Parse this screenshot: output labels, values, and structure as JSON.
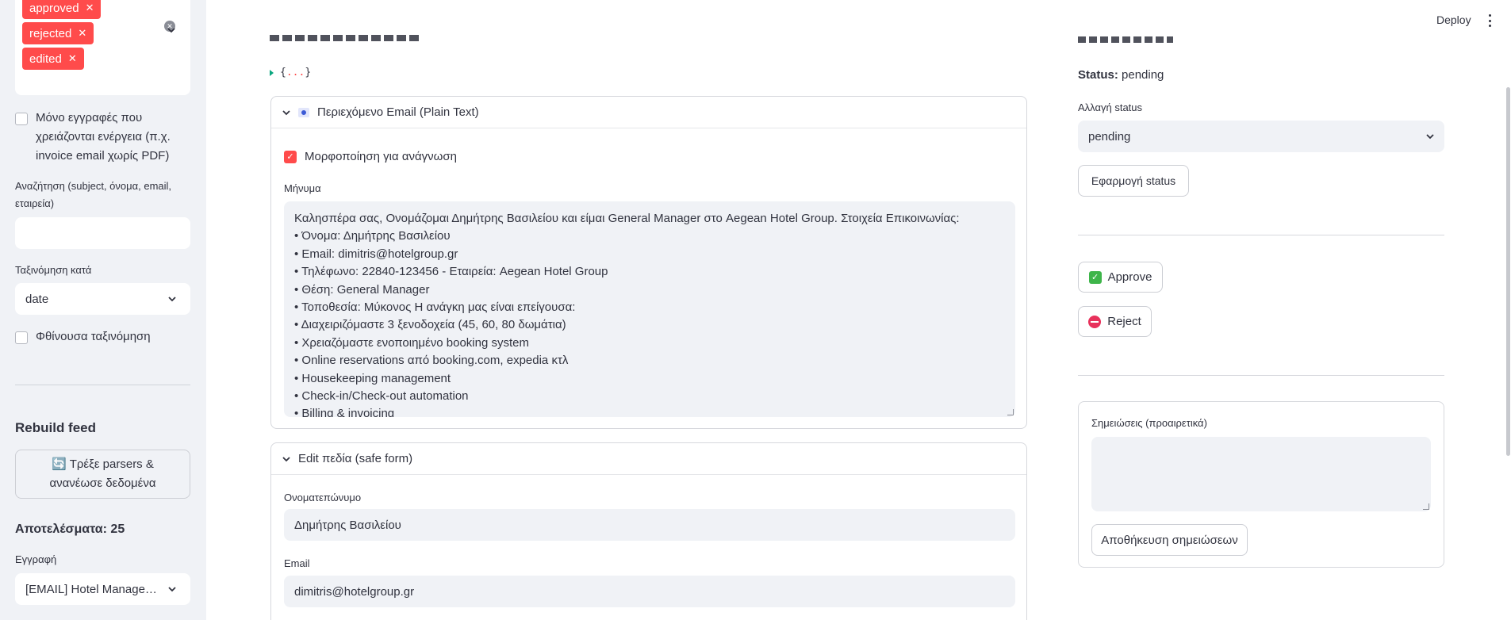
{
  "sidebar": {
    "tags": [
      "approved",
      "rejected",
      "edited"
    ],
    "only_action_label": [
      "Μόνο εγγραφές που",
      "χρειάζονται ενέργεια (π.χ.",
      "invoice email χωρίς PDF)"
    ],
    "search_label": [
      "Αναζήτηση (subject, όνομα, email,",
      "εταιρεία)"
    ],
    "search_value": "",
    "sort_label": "Ταξινόμηση κατά",
    "sort_value": "date",
    "desc_label": "Φθίνουσα ταξινόμηση",
    "rebuild_heading": "Rebuild feed",
    "rebuild_button": [
      "🔄 Τρέξε parsers &",
      "ανανέωσε δεδομένα"
    ],
    "results": "Αποτελέσματα: 25",
    "record_label": "Εγγραφή",
    "record_value": "[EMAIL] Hotel Manage…"
  },
  "topbar": {
    "deploy": "Deploy"
  },
  "main": {
    "json_preview": "{...}",
    "json_open": "{",
    "json_dots": "...",
    "json_close": "}",
    "email_expander": {
      "title": "Περιεχόμενο Email (Plain Text)",
      "format_label": "Μορφοποίηση για ανάγνωση",
      "message_label": "Μήνυμα",
      "lines": [
        "Καλησπέρα σας, Ονομάζομαι Δημήτρης Βασιλείου και είμαι General Manager στο Aegean Hotel Group. Στοιχεία Επικοινωνίας:",
        "• Όνομα: Δημήτρης Βασιλείου",
        "• Email: dimitris@hotelgroup.gr",
        "• Τηλέφωνο: 22840-123456 - Εταιρεία: Aegean Hotel Group",
        "• Θέση: General Manager",
        "• Τοποθεσία: Μύκονος Η ανάγκη μας είναι επείγουσα:",
        "• Διαχειριζόμαστε 3 ξενοδοχεία (45, 60, 80 δωμάτια)",
        "• Χρειαζόμαστε ενοποιημένο booking system",
        "• Online reservations από booking.com, expedia κτλ",
        "• Housekeeping management",
        "• Check-in/Check-out automation",
        "• Billing & invoicing"
      ]
    },
    "edit_expander": {
      "title": "Edit πεδία (safe form)",
      "name_label": "Ονοματεπώνυμο",
      "name_value": "Δημήτρης Βασιλείου",
      "email_label": "Email",
      "email_value": "dimitris@hotelgroup.gr"
    }
  },
  "right": {
    "status_key": "Status:",
    "status_value": "pending",
    "change_label": "Αλλαγή status",
    "change_value": "pending",
    "apply_button": "Εφαρμογή status",
    "approve_button": "Approve",
    "reject_button": "Reject",
    "notes_label": "Σημειώσεις (προαιρετικά)",
    "notes_value": "",
    "save_notes_button": "Αποθήκευση σημειώσεων"
  },
  "colors": {
    "accent": "#ff4b4b",
    "sidebar_bg": "#f0f2f6",
    "text": "#31333f"
  }
}
